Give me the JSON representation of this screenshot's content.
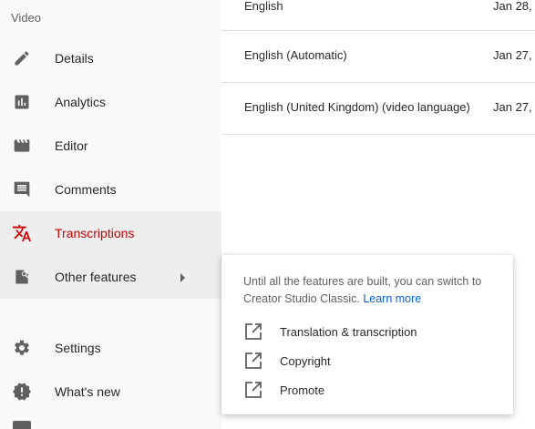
{
  "sidebar": {
    "section_label": "Video",
    "items": [
      {
        "label": "Details",
        "icon": "pencil-icon"
      },
      {
        "label": "Analytics",
        "icon": "analytics-icon"
      },
      {
        "label": "Editor",
        "icon": "clapperboard-icon"
      },
      {
        "label": "Comments",
        "icon": "comment-icon"
      },
      {
        "label": "Transcriptions",
        "icon": "translate-icon",
        "active": true
      },
      {
        "label": "Other features",
        "icon": "other-features-icon"
      },
      {
        "label": "Settings",
        "icon": "gear-icon"
      },
      {
        "label": "What's new",
        "icon": "alert-badge-icon"
      }
    ],
    "active_color": "#cc0000"
  },
  "transcriptions": {
    "rows": [
      {
        "language": "English",
        "date": "Jan 28,"
      },
      {
        "language": "English (Automatic)",
        "date": "Jan 27,"
      },
      {
        "language": "English (United Kingdom) (video language)",
        "date": "Jan 27,"
      }
    ]
  },
  "other_features_popup": {
    "description": "Until all the features are built, you can switch to Creator Studio Classic.",
    "link_label": "Learn more",
    "link_color": "#065fd4",
    "items": [
      {
        "label": "Translation & transcription",
        "icon": "external-link-icon"
      },
      {
        "label": "Copyright",
        "icon": "external-link-icon"
      },
      {
        "label": "Promote",
        "icon": "external-link-icon"
      }
    ]
  }
}
